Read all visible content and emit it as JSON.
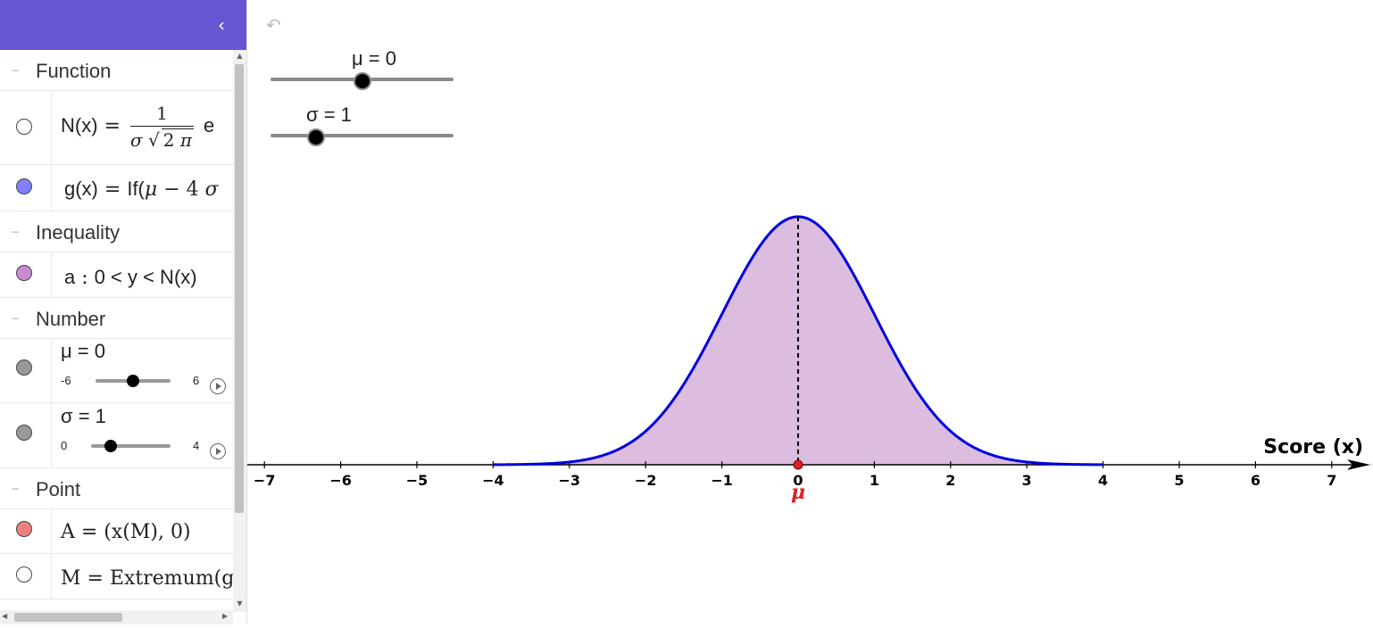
{
  "algebra": {
    "groups": {
      "function": "Function",
      "inequality": "Inequality",
      "number": "Number",
      "point": "Point"
    },
    "items": {
      "N": {
        "name": "N(x)",
        "eq": "=",
        "num": "1",
        "den_sigma": "σ",
        "den_two": "2",
        "den_pi": "π",
        "tail": "e",
        "marble_color": "#ffffff"
      },
      "g": {
        "name": "g(x)",
        "eq": "=",
        "body": "If(",
        "mu": "μ",
        "minus": "−",
        "four": "4",
        "sigma": "σ",
        "marble_color": "#8080ff"
      },
      "a": {
        "name": "a",
        "colon": ":",
        "body": "0 < y < N(x)",
        "marble_color": "#c98ad1"
      },
      "mu": {
        "label": "μ = 0",
        "min": "-6",
        "max": "6",
        "value": 0,
        "range": [
          -6,
          6
        ],
        "marble_color": "#999999"
      },
      "sigma": {
        "label": "σ = 1",
        "min": "0",
        "max": "4",
        "value": 1,
        "range": [
          0,
          4
        ],
        "marble_color": "#999999"
      },
      "A": {
        "text": "A = (x(M), 0)",
        "marble_color": "#f08080"
      },
      "M": {
        "text": "M = Extremum(g",
        "marble_color": "#ffffff"
      }
    }
  },
  "graphics": {
    "sliders": {
      "mu": {
        "label": "μ = 0",
        "value": 0,
        "range": [
          -6,
          6
        ]
      },
      "sigma": {
        "label": "σ = 1",
        "value": 1,
        "range": [
          0,
          4
        ]
      }
    },
    "axis_label": "Score (x)",
    "point_label": "μ",
    "ticks": [
      "−7",
      "−6",
      "−5",
      "−4",
      "−3",
      "−2",
      "−1",
      "0",
      "1",
      "2",
      "3",
      "4",
      "5",
      "6",
      "7"
    ],
    "colors": {
      "curve": "#0000dd",
      "fill": "#dcbcdf",
      "fill_stroke": "#d9b3d9",
      "point": "#e02020",
      "accent": "#6557d2"
    },
    "function": {
      "mu": 0,
      "sigma": 1,
      "domain": [
        -4,
        4
      ]
    }
  }
}
